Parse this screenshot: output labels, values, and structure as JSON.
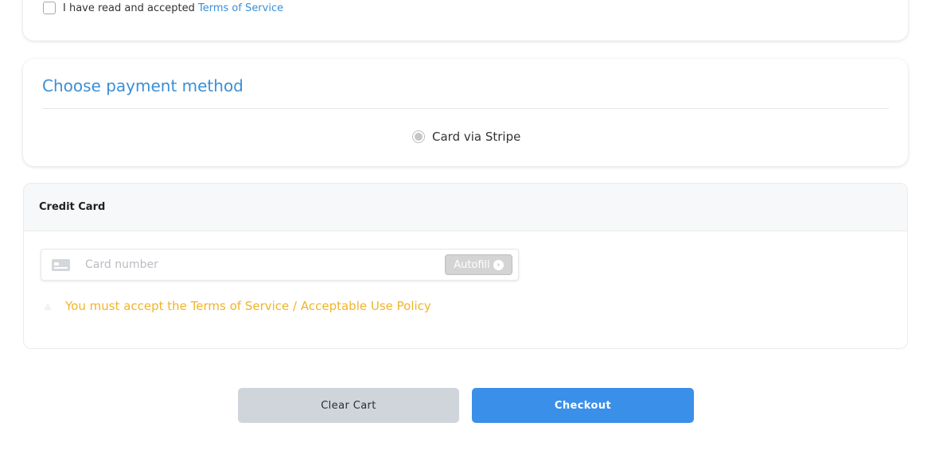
{
  "terms": {
    "text": "I have read and accepted ",
    "link": "Terms of Service"
  },
  "payment": {
    "title": "Choose payment method",
    "option_label": "Card via Stripe"
  },
  "credit_card": {
    "header": "Credit Card",
    "card_placeholder": "Card number",
    "autofill_label": "Autofill",
    "autofill_icon": "›",
    "warning": "You must accept the Terms of Service / Acceptable Use Policy"
  },
  "actions": {
    "clear_label": "Clear Cart",
    "checkout_label": "Checkout"
  },
  "colors": {
    "link": "#3a8fd6",
    "warning": "#f0b429",
    "primary": "#3a8fe8",
    "secondary": "#d0d5dc"
  },
  "icons": {
    "card": "credit-card-icon",
    "autofill": "chevron-right-circle-icon",
    "warning": "warning-triangle-icon"
  }
}
